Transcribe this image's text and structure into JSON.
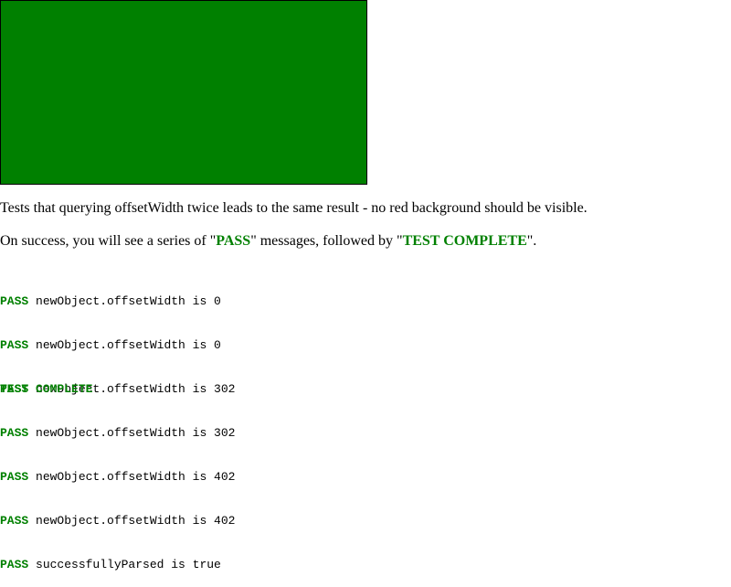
{
  "description": "Tests that querying offsetWidth twice leads to the same result - no red background should be visible.",
  "success_message": {
    "prefix": "On success, you will see a series of \"",
    "pass_word": "PASS",
    "middle": "\" messages, followed by \"",
    "complete_word": "TEST COMPLETE",
    "suffix": "\"."
  },
  "results": [
    {
      "status": "PASS",
      "text": " newObject.offsetWidth is 0"
    },
    {
      "status": "PASS",
      "text": " newObject.offsetWidth is 0"
    },
    {
      "status": "PASS",
      "text": " newObject.offsetWidth is 302"
    },
    {
      "status": "PASS",
      "text": " newObject.offsetWidth is 302"
    },
    {
      "status": "PASS",
      "text": " newObject.offsetWidth is 402"
    },
    {
      "status": "PASS",
      "text": " newObject.offsetWidth is 402"
    },
    {
      "status": "PASS",
      "text": " successfullyParsed is true"
    }
  ],
  "test_complete": "TEST COMPLETE",
  "colors": {
    "box": "#008000",
    "pass": "#008000"
  }
}
